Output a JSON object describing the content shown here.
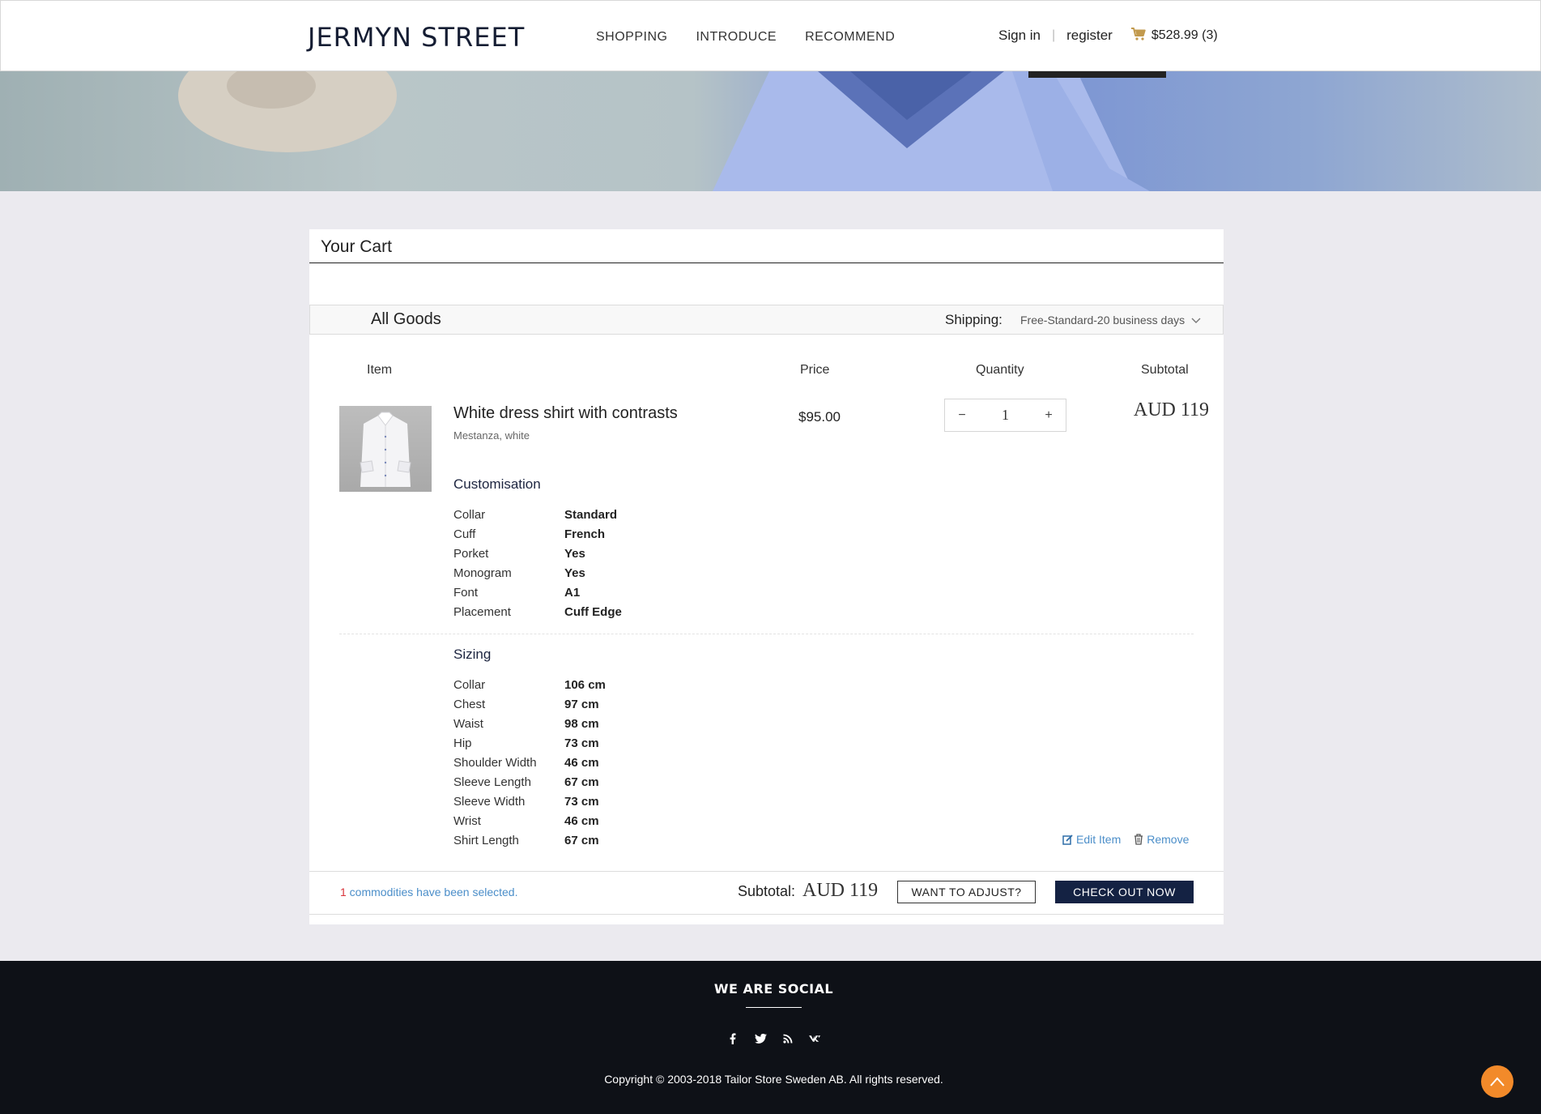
{
  "header": {
    "logo": "JERMYN STREET",
    "nav": [
      "SHOPPING",
      "INTRODUCE",
      "RECOMMEND"
    ],
    "sign_in": "Sign in",
    "separator": "|",
    "register": "register",
    "cart_total": "$528.99",
    "cart_count": "(3)"
  },
  "cart": {
    "title": "Your Cart",
    "all_goods": "All Goods",
    "shipping_label": "Shipping:",
    "shipping_value": "Free-Standard-20 business days",
    "columns": {
      "item": "Item",
      "price": "Price",
      "quantity": "Quantity",
      "subtotal": "Subtotal"
    },
    "product": {
      "name": "White dress shirt with contrasts",
      "subtitle": "Mestanza, white",
      "price": "$95.00",
      "quantity": "1",
      "qty_minus": "−",
      "qty_plus": "+",
      "subtotal": "AUD  119"
    },
    "customisation": {
      "title": "Customisation",
      "rows": [
        {
          "k": "Collar",
          "v": "Standard"
        },
        {
          "k": "Cuff",
          "v": "French"
        },
        {
          "k": "Porket",
          "v": "Yes"
        },
        {
          "k": "Monogram",
          "v": "Yes"
        },
        {
          "k": "Font",
          "v": "A1"
        },
        {
          "k": "Placement",
          "v": "Cuff Edge"
        }
      ]
    },
    "sizing": {
      "title": "Sizing",
      "rows": [
        {
          "k": "Collar",
          "v": "106 cm"
        },
        {
          "k": "Chest",
          "v": "97  cm"
        },
        {
          "k": "Waist",
          "v": "98  cm"
        },
        {
          "k": "Hip",
          "v": "73 cm"
        },
        {
          "k": "Shoulder Width",
          "v": "46 cm"
        },
        {
          "k": "Sleeve Length",
          "v": "67 cm"
        },
        {
          "k": "Sleeve Width",
          "v": "73 cm"
        },
        {
          "k": "Wrist",
          "v": "46 cm"
        },
        {
          "k": "Shirt Length",
          "v": "67 cm"
        }
      ]
    },
    "edit_item": "Edit Item",
    "remove": "Remove",
    "selected_count": "1",
    "selected_text": " commodities have been selected.",
    "subtotal_label": "Subtotal:",
    "subtotal_amount": "AUD  119",
    "adjust_button": "WANT TO ADJUST?",
    "checkout_button": "CHECK OUT NOW"
  },
  "footer": {
    "social_title": "WE ARE SOCIAL",
    "social_icons": [
      "facebook-icon",
      "twitter-icon",
      "rss-icon",
      "vk-icon"
    ],
    "copyright": "Copyright © 2003-2018 Tailor Store Sweden AB. All rights reserved."
  },
  "colors": {
    "brand_navy": "#142243",
    "link_blue": "#4b8ec9",
    "accent_orange": "#f28a2a",
    "footer_bg": "#0e1117"
  }
}
